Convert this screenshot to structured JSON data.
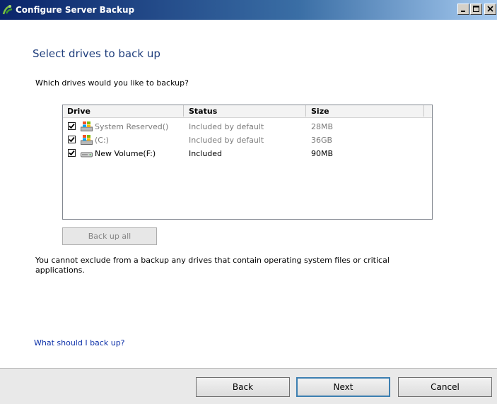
{
  "window": {
    "title": "Configure Server Backup"
  },
  "page": {
    "heading": "Select drives to back up",
    "question": "Which drives would you like to backup?",
    "note": "You cannot exclude from a backup any drives that contain operating system files or critical applications.",
    "help_link": "What should I back up?"
  },
  "drive_list": {
    "columns": [
      "Drive",
      "Status",
      "Size"
    ],
    "rows": [
      {
        "name": "System Reserved()",
        "status": "Included by default",
        "size": "28MB",
        "checked": true,
        "icon": "windows-drive-icon"
      },
      {
        "name": "(C:)",
        "status": "Included by default",
        "size": "36GB",
        "checked": true,
        "icon": "windows-drive-icon"
      },
      {
        "name": "New Volume(F:)",
        "status": "Included",
        "size": "90MB",
        "checked": true,
        "icon": "hard-drive-icon"
      }
    ]
  },
  "buttons": {
    "backup_all": "Back up all",
    "back": "Back",
    "next": "Next",
    "cancel": "Cancel"
  },
  "colors": {
    "heading": "#1f3e7c",
    "link": "#0b2fa8",
    "titlebar_start": "#0a246a"
  }
}
